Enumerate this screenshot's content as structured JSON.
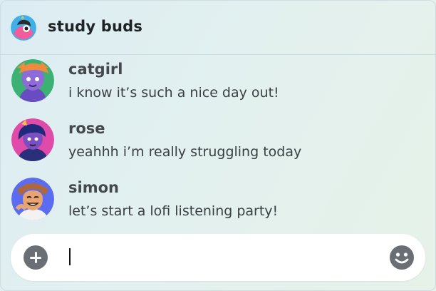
{
  "app": {
    "group_name": "study buds",
    "group_icon": "group-avatar-icon"
  },
  "messages": [
    {
      "author": "catgirl",
      "text": "i know it’s such a nice day out!",
      "avatar": "catgirl-avatar",
      "avatar_bg": "#3bb273"
    },
    {
      "author": "rose",
      "text": "yeahhh i’m really struggling today",
      "avatar": "rose-avatar",
      "avatar_bg": "#e04aa8"
    },
    {
      "author": "simon",
      "text": "let’s start a lofi listening party!",
      "avatar": "simon-avatar",
      "avatar_bg": "#5b6cf0"
    }
  ],
  "composer": {
    "input_value": "",
    "add_icon": "plus-circle-icon",
    "emoji_icon": "emoji-smile-icon"
  },
  "colors": {
    "background_start": "#dcecf3",
    "background_end": "#e6f2e8",
    "icon_gray": "#6a6f75"
  }
}
